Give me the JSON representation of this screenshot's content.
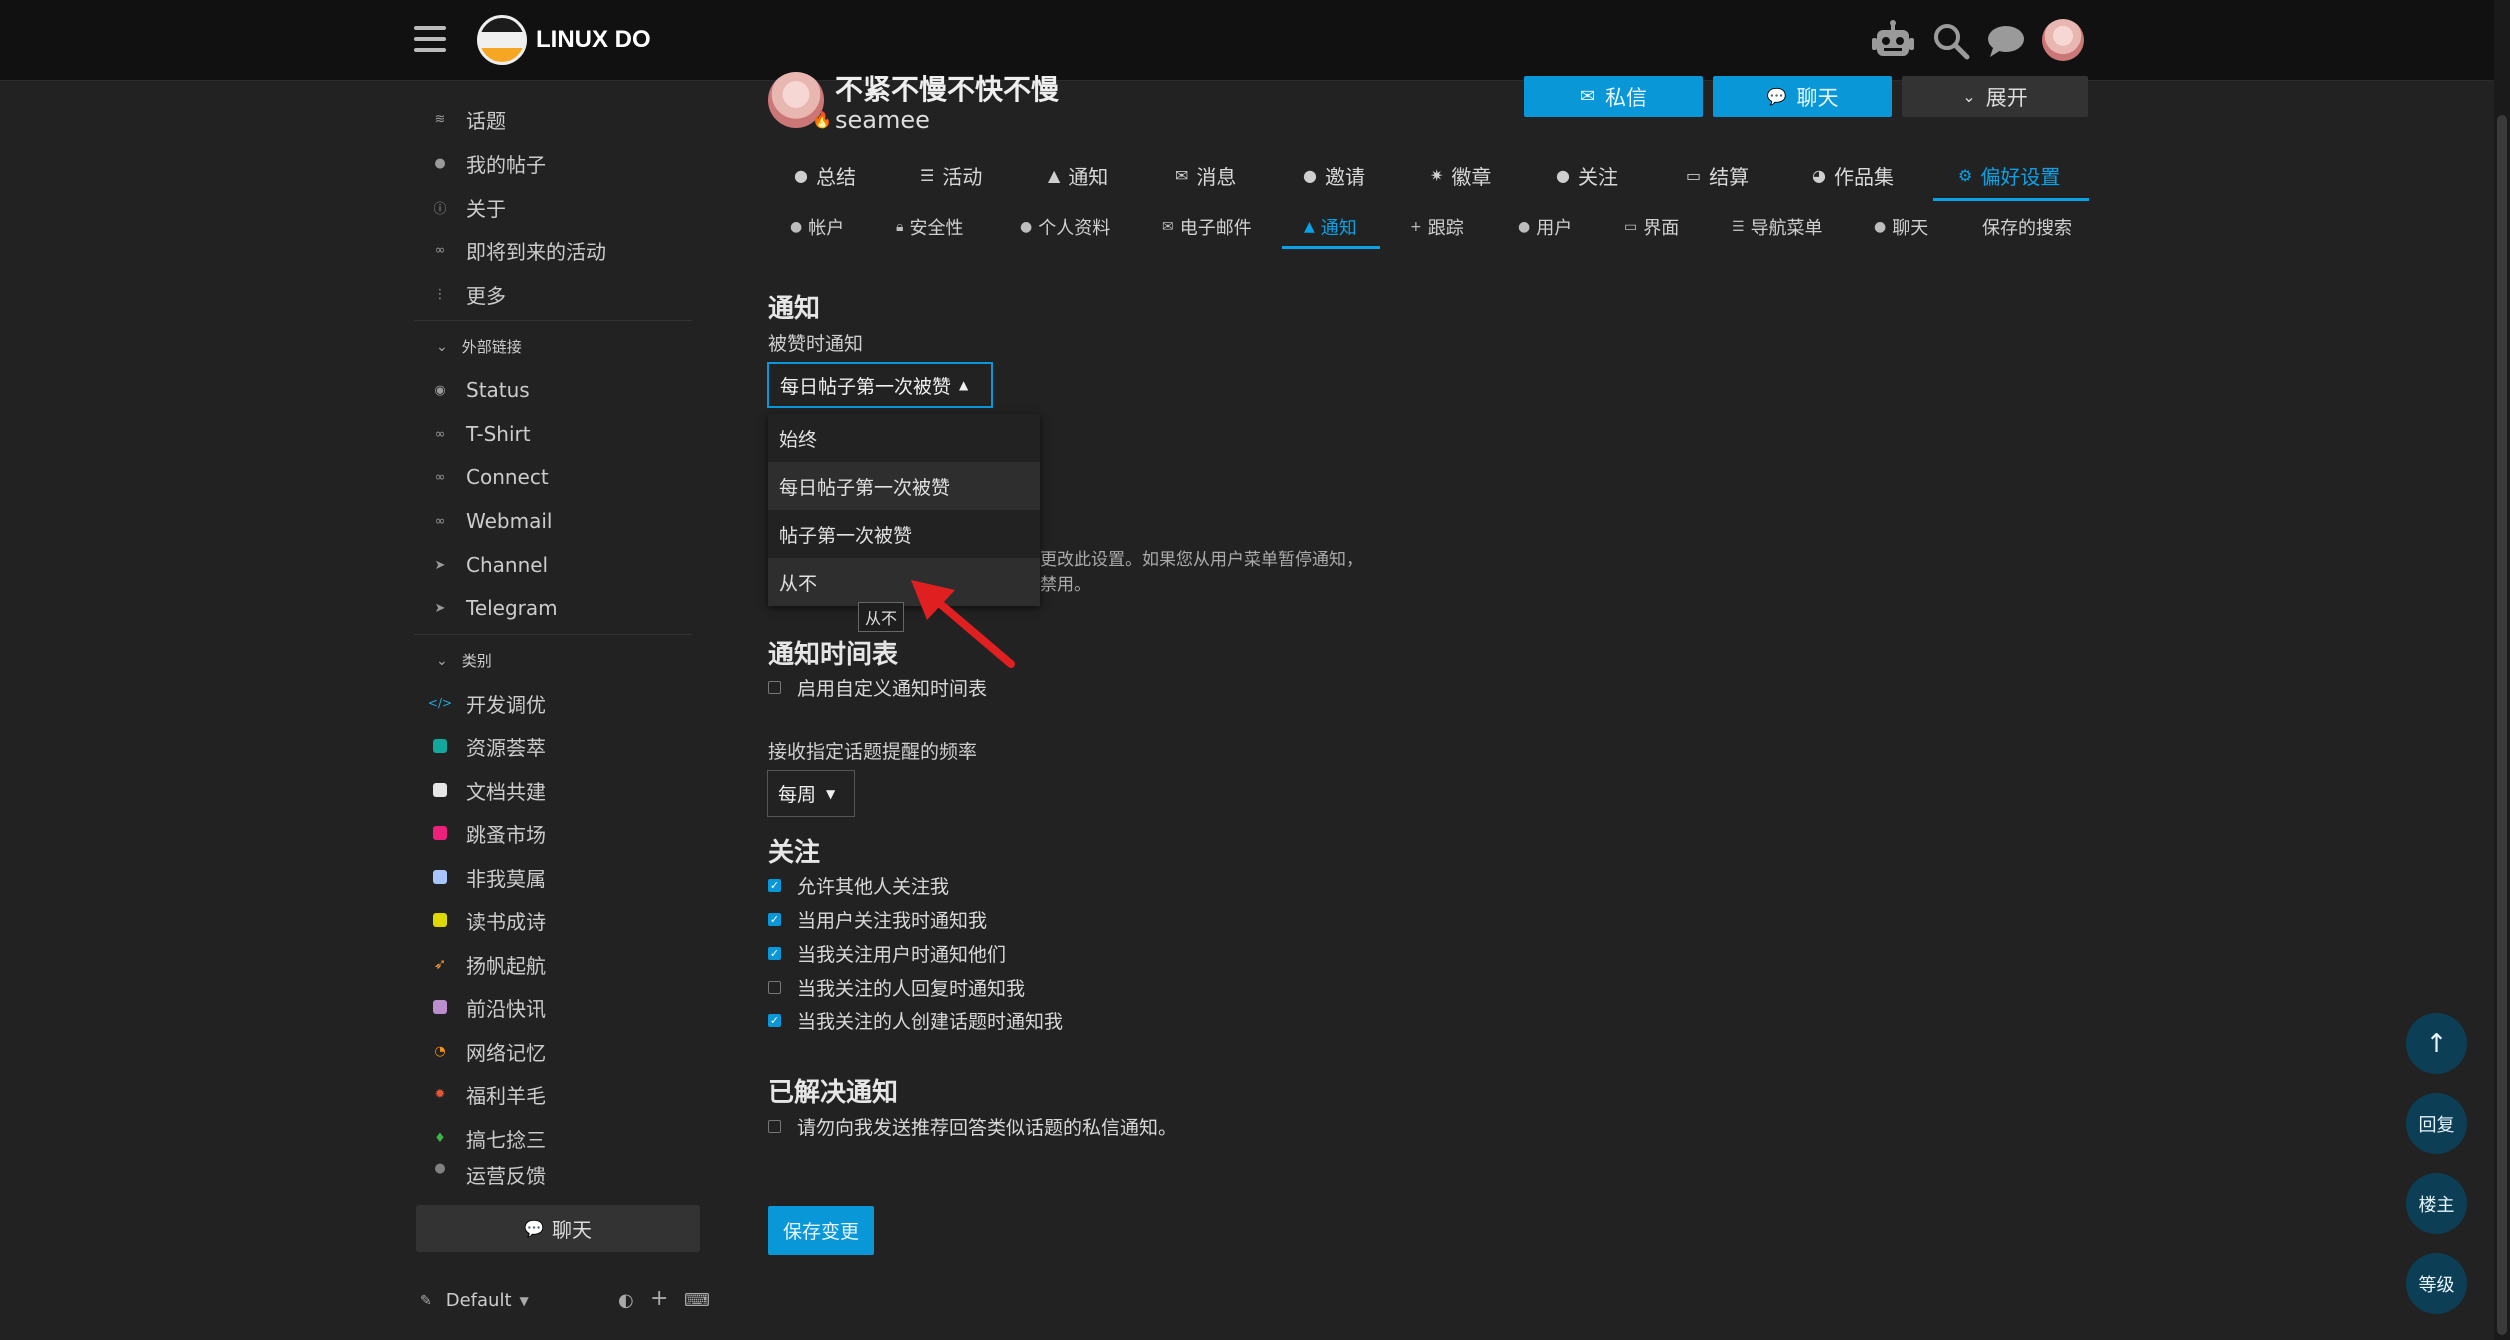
{
  "header": {
    "logo_text": "LINUX DO",
    "icons": [
      "robot-icon",
      "search-icon",
      "chat-icon",
      "user-avatar"
    ]
  },
  "sidebar": {
    "items": [
      {
        "label": "话题",
        "icon": "layers-icon"
      },
      {
        "label": "我的帖子",
        "icon": "user-icon"
      },
      {
        "label": "关于",
        "icon": "info-icon"
      },
      {
        "label": "即将到来的活动",
        "icon": "link-icon"
      },
      {
        "label": "更多",
        "icon": "more-icon"
      }
    ],
    "external_section": "外部链接",
    "external": [
      {
        "label": "Status",
        "icon": "eye-icon"
      },
      {
        "label": "T-Shirt",
        "icon": "link-icon"
      },
      {
        "label": "Connect",
        "icon": "link-icon"
      },
      {
        "label": "Webmail",
        "icon": "link-icon"
      },
      {
        "label": "Channel",
        "icon": "send-icon"
      },
      {
        "label": "Telegram",
        "icon": "send-icon"
      }
    ],
    "category_section": "类别",
    "categories": [
      {
        "label": "开发调优",
        "color": "#25aae1"
      },
      {
        "label": "资源荟萃",
        "color": "#12a89d"
      },
      {
        "label": "文档共建",
        "color": "#e6e6e6"
      },
      {
        "label": "跳蚤市场",
        "color": "#ed207b"
      },
      {
        "label": "非我莫属",
        "color": "#a8c6fe"
      },
      {
        "label": "读书成诗",
        "color": "#e0d900"
      },
      {
        "label": "扬帆起航",
        "color": "#ff9838"
      },
      {
        "label": "前沿快讯",
        "color": "#bb8fce"
      },
      {
        "label": "网络记忆",
        "color": "#f7941d"
      },
      {
        "label": "福利羊毛",
        "color": "#e45735"
      },
      {
        "label": "搞七捻三",
        "color": "#3ab54a"
      },
      {
        "label": "运营反馈",
        "color": "#808281"
      }
    ],
    "chat_button": "聊天",
    "theme_label": "Default"
  },
  "profile": {
    "display_name": "不紧不慢不快不慢",
    "username": "seamee",
    "buttons": {
      "message": "私信",
      "chat": "聊天",
      "expand": "展开"
    }
  },
  "nav_main": [
    {
      "label": "总结",
      "icon": "user-icon"
    },
    {
      "label": "活动",
      "icon": "list-icon"
    },
    {
      "label": "通知",
      "icon": "bell-icon"
    },
    {
      "label": "消息",
      "icon": "envelope-icon"
    },
    {
      "label": "邀请",
      "icon": "user-plus-icon"
    },
    {
      "label": "徽章",
      "icon": "badge-icon"
    },
    {
      "label": "关注",
      "icon": "users-icon"
    },
    {
      "label": "结算",
      "icon": "card-icon"
    },
    {
      "label": "作品集",
      "icon": "palette-icon"
    },
    {
      "label": "偏好设置",
      "icon": "gear-icon",
      "active": true
    }
  ],
  "nav_sub": [
    {
      "label": "帐户",
      "icon": "user-icon"
    },
    {
      "label": "安全性",
      "icon": "lock-icon"
    },
    {
      "label": "个人资料",
      "icon": "user-icon"
    },
    {
      "label": "电子邮件",
      "icon": "envelope-icon"
    },
    {
      "label": "通知",
      "icon": "bell-icon",
      "active": true
    },
    {
      "label": "跟踪",
      "icon": "plus-icon"
    },
    {
      "label": "用户",
      "icon": "users-icon"
    },
    {
      "label": "界面",
      "icon": "desktop-icon"
    },
    {
      "label": "导航菜单",
      "icon": "bars-icon"
    },
    {
      "label": "聊天",
      "icon": "chat-icon"
    },
    {
      "label": "保存的搜索",
      "icon": ""
    }
  ],
  "notifications": {
    "title": "通知",
    "like_label": "被赞时通知",
    "like_selected": "每日帖子第一次被赞",
    "like_options": [
      "始终",
      "每日帖子第一次被赞",
      "帖子第一次被赞",
      "从不"
    ],
    "tooltip": "从不",
    "hidden_desc_line1": "更改此设置。如果您从用户菜单暂停通知，",
    "hidden_desc_line2": "禁用。"
  },
  "schedule": {
    "title": "通知时间表",
    "custom_label": "启用自定义通知时间表",
    "freq_label": "接收指定话题提醒的频率",
    "freq_value": "每周"
  },
  "follow": {
    "title": "关注",
    "options": [
      {
        "label": "允许其他人关注我",
        "checked": true
      },
      {
        "label": "当用户关注我时通知我",
        "checked": true
      },
      {
        "label": "当我关注用户时通知他们",
        "checked": true
      },
      {
        "label": "当我关注的人回复时通知我",
        "checked": false
      },
      {
        "label": "当我关注的人创建话题时通知我",
        "checked": true
      }
    ]
  },
  "solved": {
    "title": "已解决通知",
    "label": "请勿向我发送推荐回答类似话题的私信通知。",
    "checked": false
  },
  "save_button": "保存变更",
  "floating": {
    "top": "↑",
    "reply": "回复",
    "op": "楼主",
    "level": "等级"
  }
}
